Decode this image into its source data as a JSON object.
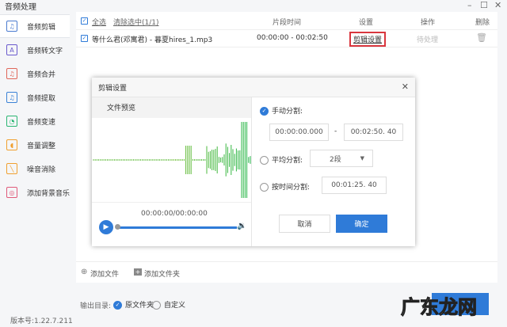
{
  "window": {
    "title": "音频处理",
    "minimize": "–",
    "maximize": "☐",
    "close": "✕"
  },
  "sidebar": {
    "items": [
      {
        "label": "音频剪辑",
        "icon": "♫",
        "color": "#4a7bd0"
      },
      {
        "label": "音频转文字",
        "icon": "A",
        "color": "#6a5acd"
      },
      {
        "label": "音频合并",
        "icon": "♫",
        "color": "#e0675a"
      },
      {
        "label": "音频提取",
        "icon": "♫",
        "color": "#3b82d6"
      },
      {
        "label": "音频变速",
        "icon": "◔",
        "color": "#2bb673"
      },
      {
        "label": "音量调整",
        "icon": "◖",
        "color": "#f0a030"
      },
      {
        "label": "噪音消除",
        "icon": "╲",
        "color": "#f0a030"
      },
      {
        "label": "添加背景音乐",
        "icon": "◎",
        "color": "#e05a7a"
      }
    ]
  },
  "table": {
    "select_all": "全选",
    "clear_selection": "清除选中(1/1)",
    "col_time": "片段时间",
    "col_settings": "设置",
    "col_action": "操作",
    "col_delete": "删除",
    "rows": [
      {
        "name": "等什么君(邓寓君) - 暮夏hires_1.mp3",
        "time": "00:00:00 - 00:02:50",
        "settings": "剪辑设置",
        "status": "待处理"
      }
    ]
  },
  "footer": {
    "add_file": "添加文件",
    "add_folder": "添加文件夹",
    "output_label": "输出目录:",
    "opt_original": "原文件夹",
    "opt_custom": "自定义",
    "version": "版本号:1.22.7.211",
    "watermark": "广东龙网"
  },
  "dialog": {
    "title": "剪辑设置",
    "close": "✕",
    "preview_label": "文件预览",
    "playback_time": "00:00:00/00:00:00",
    "manual_label": "手动分割:",
    "start": "00:00:00.000",
    "dash": "-",
    "end": "00:02:50. 40",
    "average_label": "平均分割:",
    "segments": "2段",
    "by_time_label": "按时间分割:",
    "interval": "00:01:25. 40",
    "cancel": "取消",
    "confirm": "确定"
  },
  "colors": {
    "accent": "#2f7bd8",
    "highlight": "#d9363e"
  }
}
